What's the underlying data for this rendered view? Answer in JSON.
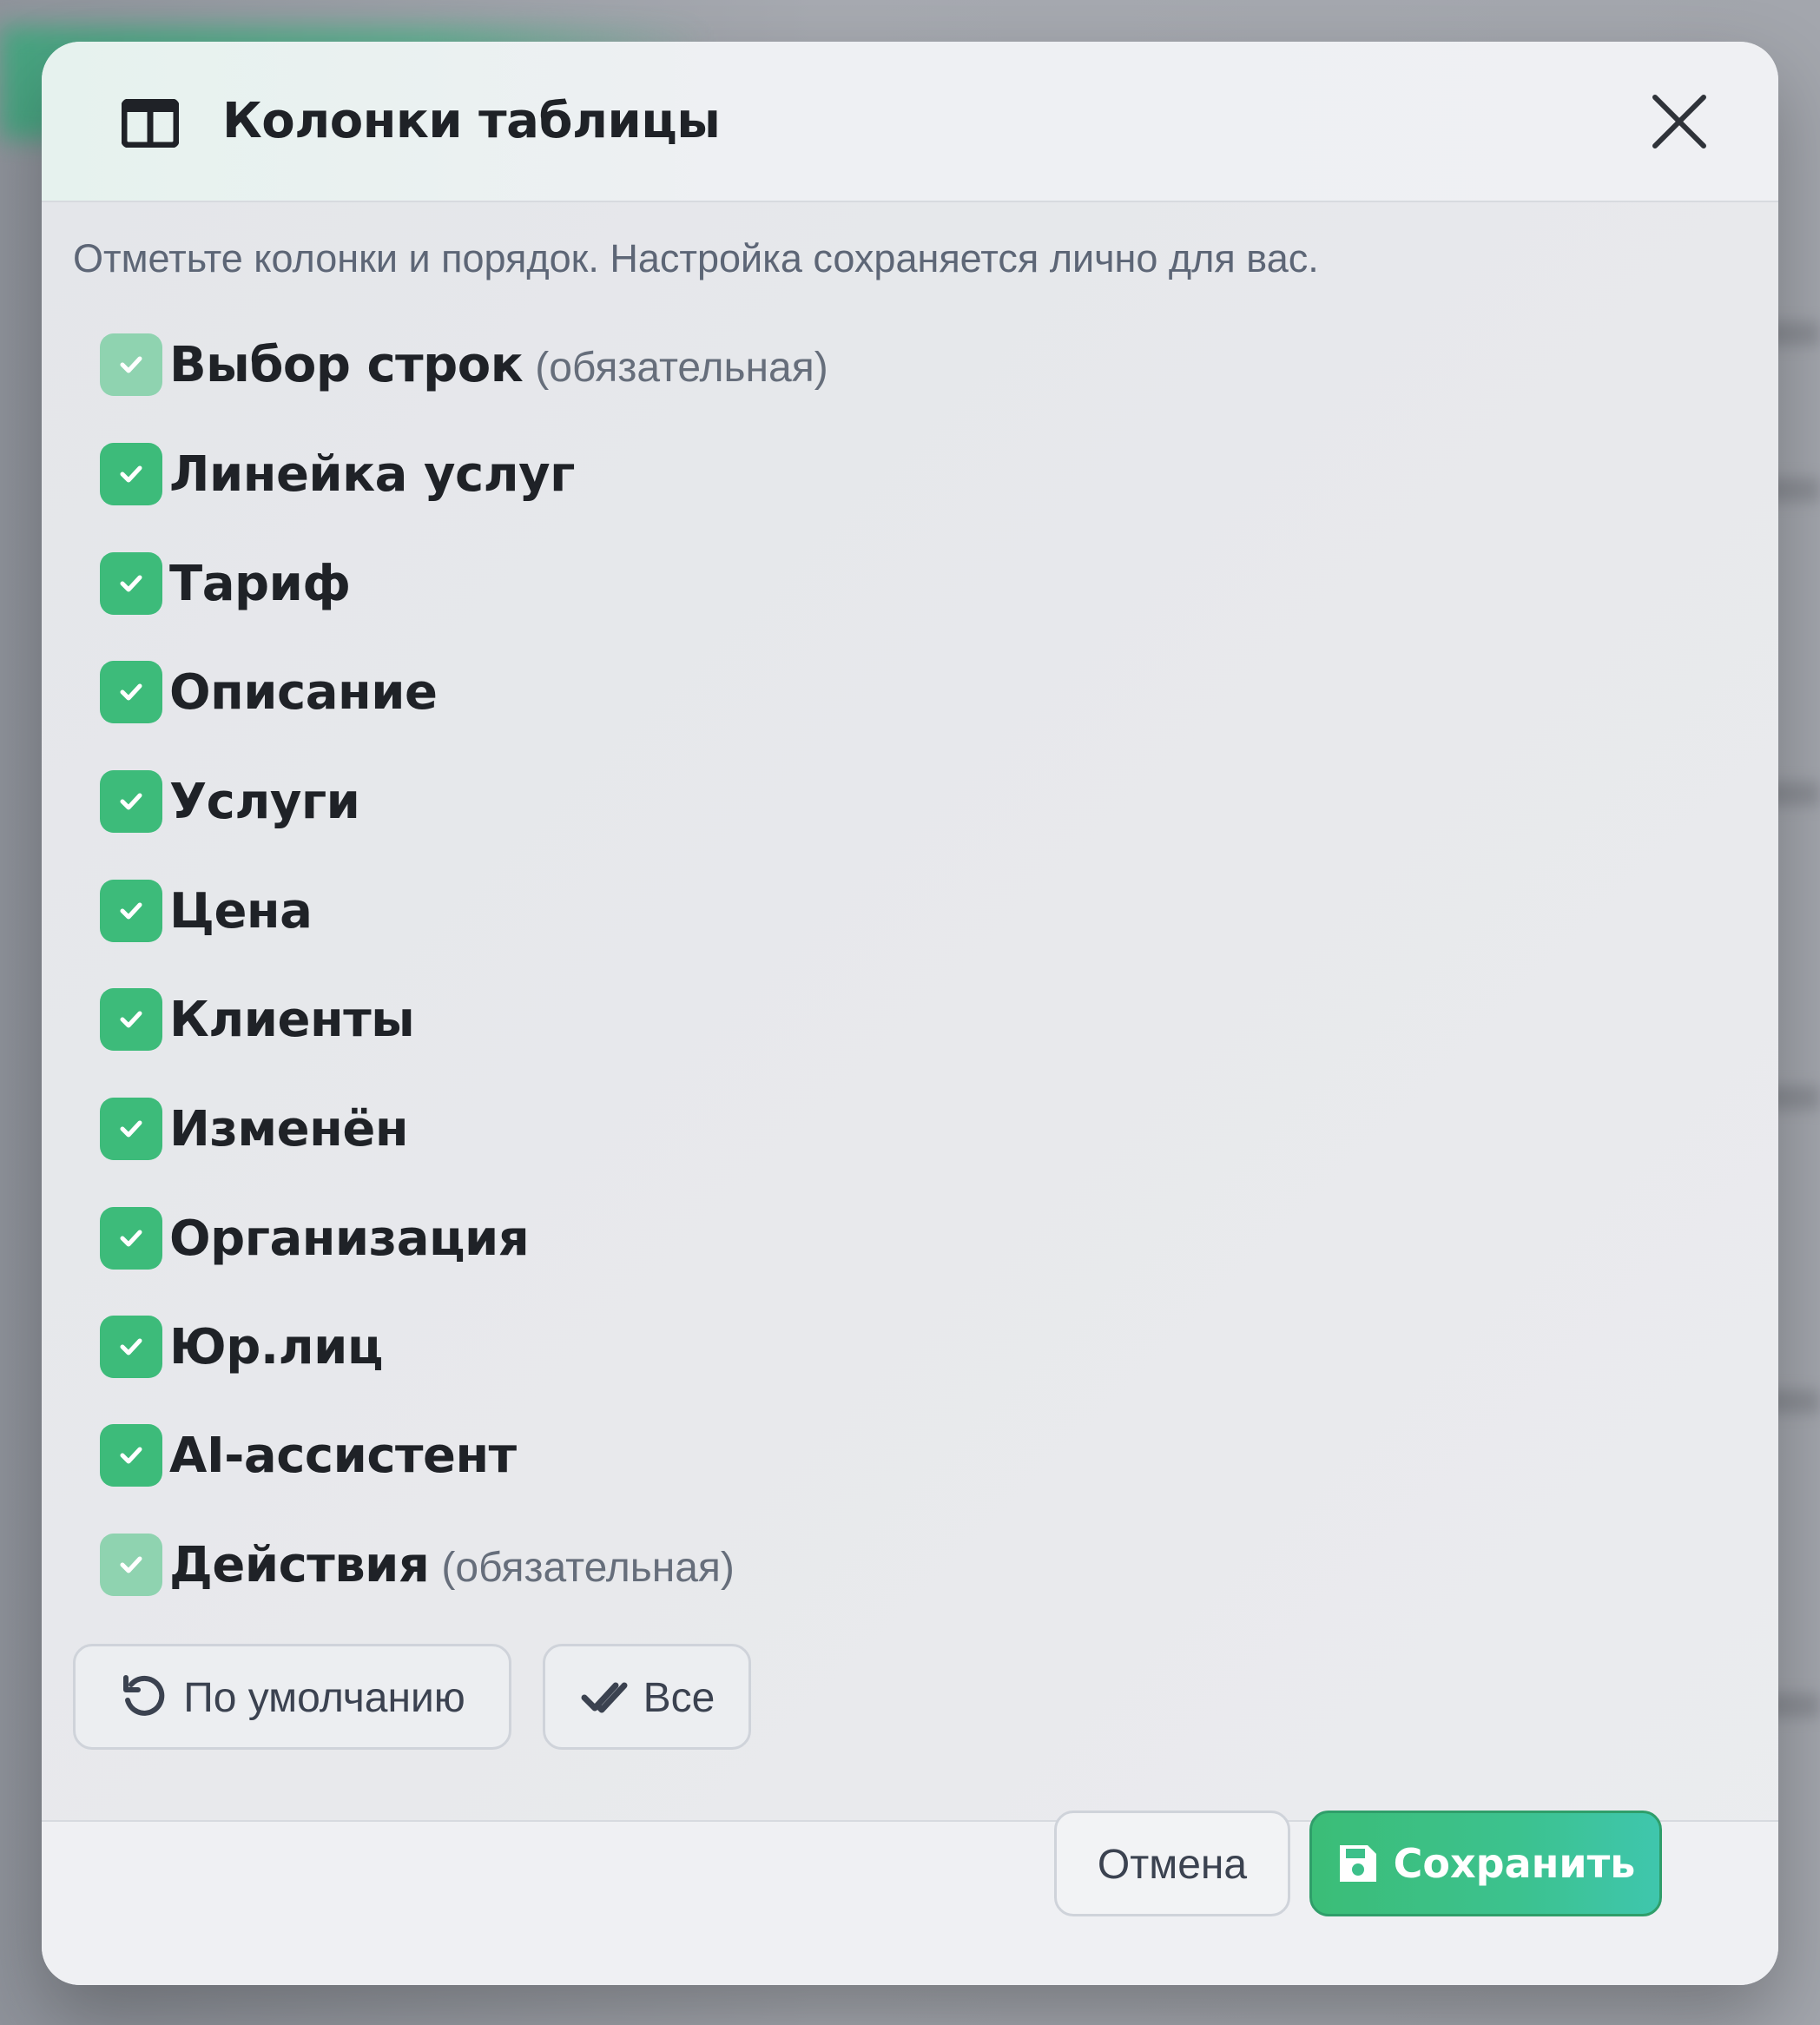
{
  "dialog": {
    "title": "Колонки таблицы",
    "hint": "Отметьте колонки и порядок. Настройка сохраняется лично для вас.",
    "columns": [
      {
        "label": "Выбор строк",
        "note": "(обязательная)",
        "checked": true,
        "disabled": true
      },
      {
        "label": "Линейка услуг",
        "checked": true,
        "disabled": false
      },
      {
        "label": "Тариф",
        "checked": true,
        "disabled": false
      },
      {
        "label": "Описание",
        "checked": true,
        "disabled": false
      },
      {
        "label": "Услуги",
        "checked": true,
        "disabled": false
      },
      {
        "label": "Цена",
        "checked": true,
        "disabled": false
      },
      {
        "label": "Клиенты",
        "checked": true,
        "disabled": false
      },
      {
        "label": "Изменён",
        "checked": true,
        "disabled": false
      },
      {
        "label": "Организация",
        "checked": true,
        "disabled": false
      },
      {
        "label": "Юр.лиц",
        "checked": true,
        "disabled": false
      },
      {
        "label": "AI-ассистент",
        "checked": true,
        "disabled": false
      },
      {
        "label": "Действия",
        "note": "(обязательная)",
        "checked": true,
        "disabled": true
      }
    ],
    "actions": {
      "default_label": "По умолчанию",
      "all_label": "Все"
    },
    "footer": {
      "cancel_label": "Отмена",
      "save_label": "Сохранить"
    }
  },
  "colors": {
    "accent": "#3dbb7a",
    "accent_disabled": "#8fd3b0",
    "text": "#1f2227",
    "muted": "#5d6676"
  },
  "icons": {
    "header": "table-columns-icon",
    "close": "close-icon",
    "check": "check-icon",
    "reset": "undo-icon",
    "all": "double-check-icon",
    "save": "floppy-disk-icon"
  }
}
